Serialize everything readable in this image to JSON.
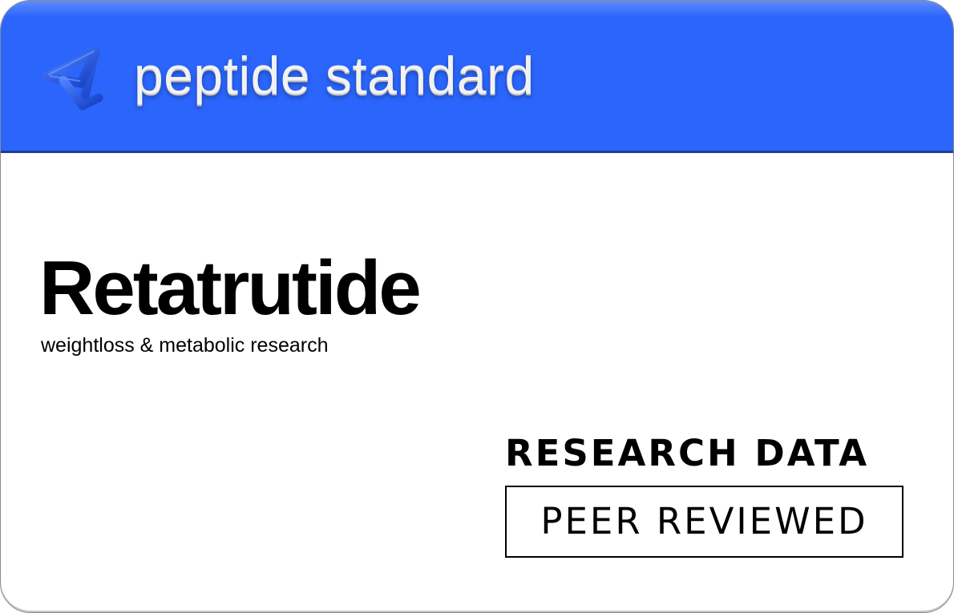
{
  "brand": {
    "logo_icon": "peptide-standard-logo-icon",
    "name": "peptide standard"
  },
  "product": {
    "title": "Retatrutide",
    "subtitle": "weightloss & metabolic research"
  },
  "badges": {
    "research_data": "RESEARCH DATA",
    "peer_reviewed": "PEER REVIEWED"
  },
  "colors": {
    "header_bg": "#2b65fc",
    "logo": "#2256e6",
    "text": "#000000",
    "brand_text": "#f2f2f2"
  }
}
